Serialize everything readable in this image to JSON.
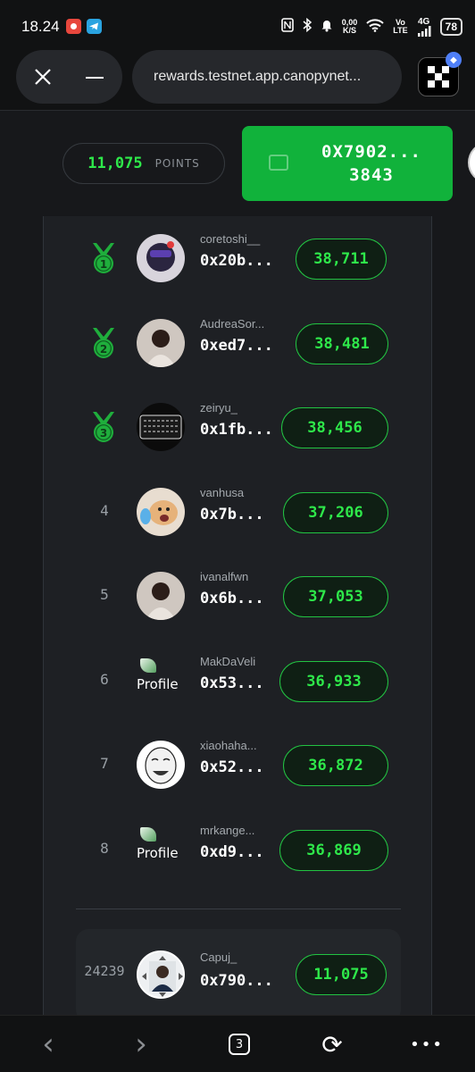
{
  "status_bar": {
    "time": "18.24",
    "net_speed_top": "0,00",
    "net_speed_bottom": "K/S",
    "volte_top": "Vo",
    "volte_bottom": "LTE",
    "signal_label": "4G",
    "battery": "78"
  },
  "browser": {
    "url": "rewards.testnet.app.canopynet..."
  },
  "header": {
    "points_value": "11,075",
    "points_label": "POINTS",
    "wallet_line1": "0X7902...",
    "wallet_line2": "3843",
    "accent": "#2ee84a",
    "wallet_bg": "#11b23b"
  },
  "leaderboard": [
    {
      "rank": "1",
      "medal": true,
      "username": "coretoshi__",
      "address": "0x20b...",
      "score": "38,711",
      "avatar": "hooded-avatar"
    },
    {
      "rank": "2",
      "medal": true,
      "username": "AudreaSor...",
      "address": "0xed7...",
      "score": "38,481",
      "avatar": "photo-avatar"
    },
    {
      "rank": "3",
      "medal": true,
      "username": "zeiryu_",
      "address": "0x1fb...",
      "score": "38,456",
      "avatar": "keyboard-avatar"
    },
    {
      "rank": "4",
      "medal": false,
      "username": "vanhusa",
      "address": "0x7b...",
      "score": "37,206",
      "avatar": "dog-avatar"
    },
    {
      "rank": "5",
      "medal": false,
      "username": "ivanalfwn",
      "address": "0x6b...",
      "score": "37,053",
      "avatar": "photo-avatar"
    },
    {
      "rank": "6",
      "medal": false,
      "username": "MakDaVeli",
      "address": "0x53...",
      "score": "36,933",
      "avatar": "broken-image",
      "broken_alt": "Profile"
    },
    {
      "rank": "7",
      "medal": false,
      "username": "xiaohaha...",
      "address": "0x52...",
      "score": "36,872",
      "avatar": "meme-face-avatar"
    },
    {
      "rank": "8",
      "medal": false,
      "username": "mrkange...",
      "address": "0xd9...",
      "score": "36,869",
      "avatar": "broken-image",
      "broken_alt": "Profile"
    }
  ],
  "current_user": {
    "rank": "24239",
    "username": "Capuj_",
    "address": "0x790...",
    "score": "11,075"
  },
  "bottom_nav": {
    "back_icon": "‹",
    "forward_icon": "›",
    "tab_count": "3",
    "refresh_icon": "⟳",
    "more_icon": "•••"
  }
}
